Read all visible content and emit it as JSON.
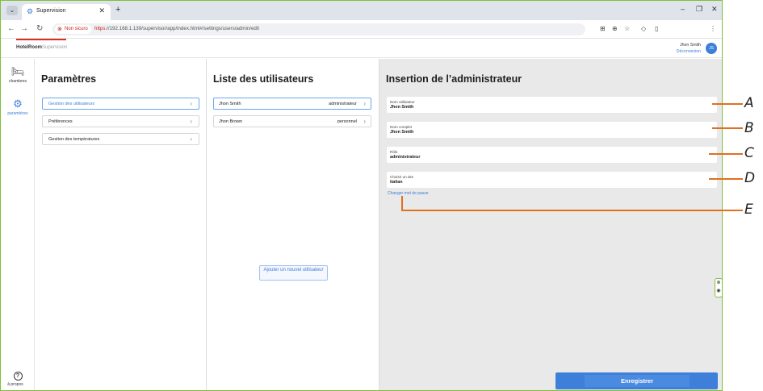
{
  "browser": {
    "tab_title": "Supervision",
    "new_tab_glyph": "+",
    "security_label": "Non sicuro",
    "url_scheme": "https",
    "url_rest": "://192.168.1.139/supervisor/app/index.html#/settings/users/admin/edit"
  },
  "app": {
    "brand": "HotelRoom",
    "brand_sub": "Supervision",
    "user_name": "Jhon Smith",
    "logout_label": "Déconnexion",
    "avatar_initials": "JS"
  },
  "rail": {
    "items": [
      {
        "label": "chambres",
        "icon": "bed-icon"
      },
      {
        "label": "paramètres",
        "icon": "gear-icon"
      }
    ],
    "help_label": "à propos"
  },
  "settings": {
    "title": "Paramètres",
    "items": [
      {
        "label": "Gestion des utilisateurs",
        "active": true
      },
      {
        "label": "Préférences",
        "active": false
      },
      {
        "label": "Gestion des températures",
        "active": false
      }
    ]
  },
  "users": {
    "title": "Liste des utilisateurs",
    "list": [
      {
        "name": "Jhon Smith",
        "role": "administrateur"
      },
      {
        "name": "Jhon Brown",
        "role": "personnel"
      }
    ],
    "add_button": "Ajouter un nouvel utilisateur"
  },
  "admin_form": {
    "title": "Insertion de l’administrateur",
    "fields": [
      {
        "label": "Nom utilisateur",
        "value": "Jhon Smith"
      },
      {
        "label": "Nom complet",
        "value": "Jhon Smith"
      },
      {
        "label": "Rôle",
        "value": "administrateur"
      },
      {
        "label": "Choisir un site",
        "value": "italian"
      }
    ],
    "change_password": "Changer mot de passe",
    "save_button": "Enregistrer"
  },
  "callouts": [
    "A",
    "B",
    "C",
    "D",
    "E"
  ],
  "colors": {
    "accent": "#3d7fd9",
    "callout": "#e07020",
    "window_border": "#7fbf3f",
    "danger": "#c5221f"
  }
}
